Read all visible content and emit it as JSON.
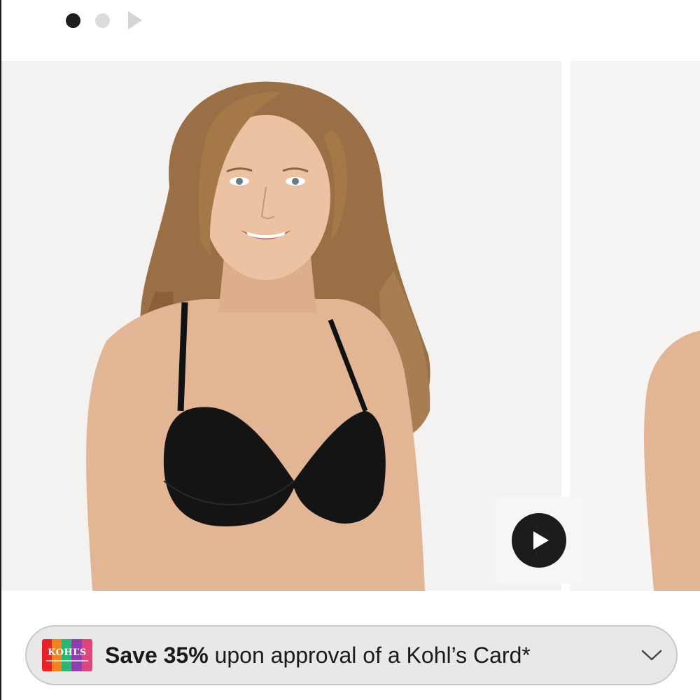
{
  "carousel": {
    "total_slides": 2,
    "active_index": 0
  },
  "promo": {
    "bold_text": "Save 35%",
    "text": " upon approval of a Kohl’s Card*",
    "card_logo_text": "KOHĽS"
  },
  "colors": {
    "dot_active": "#1e1e1e",
    "dot_inactive": "#dcdcdc",
    "promo_background": "#e8e8e8",
    "play_button": "#1c1c1c"
  },
  "icons": {
    "indicator_play": "play-triangle",
    "video_play": "play-circle",
    "promo_toggle": "chevron-down"
  }
}
